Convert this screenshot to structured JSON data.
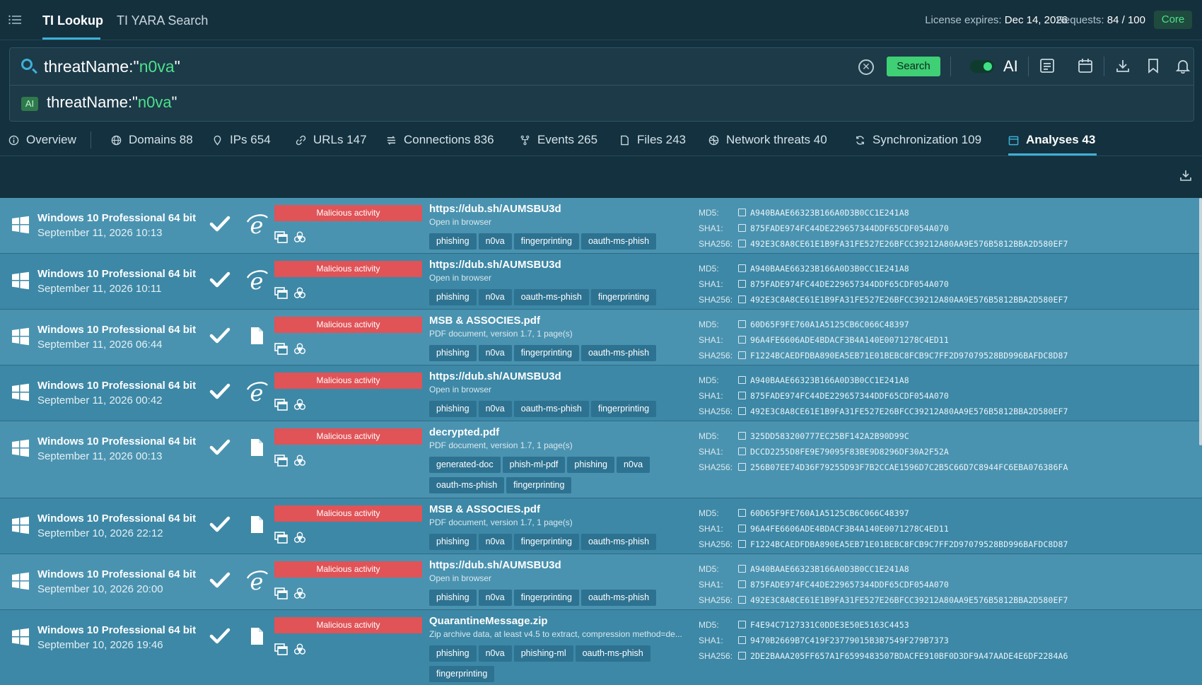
{
  "nav": {
    "tabs": [
      {
        "label": "TI Lookup"
      },
      {
        "label": "TI YARA Search"
      }
    ],
    "license_label": "License expires:",
    "license_value": "Dec 14, 2026",
    "requests_label": "Requests:",
    "requests_value": "84 / 100",
    "plan_badge": "Core"
  },
  "search": {
    "query_prefix": "threatName:\"",
    "query_value": "n0va",
    "query_suffix": "\"",
    "button_label": "Search",
    "ai_toggle": true,
    "ai_label": "AI",
    "ai_badge": "AI",
    "ai_query_prefix": "threatName:\"",
    "ai_query_value": "n0va",
    "ai_query_suffix": "\""
  },
  "tabs": [
    {
      "label": "Overview",
      "icon": "info-icon"
    },
    {
      "label": "Domains 88",
      "icon": "globe-icon"
    },
    {
      "label": "IPs 654",
      "icon": "pin-icon"
    },
    {
      "label": "URLs 147",
      "icon": "link-icon"
    },
    {
      "label": "Connections 836",
      "icon": "connections-icon"
    },
    {
      "label": "Events 265",
      "icon": "events-icon"
    },
    {
      "label": "Files 243",
      "icon": "file-icon"
    },
    {
      "label": "Network threats 40",
      "icon": "network-icon"
    },
    {
      "label": "Synchronization 109",
      "icon": "sync-icon"
    },
    {
      "label": "Analyses 43",
      "icon": "calendar-icon",
      "active": true
    }
  ],
  "hash_labels": {
    "md5": "MD5:",
    "sha1": "SHA1:",
    "sha256": "SHA256:"
  },
  "rows": [
    {
      "os": "Windows 10 Professional 64 bit",
      "date": "September 11, 2026 10:13",
      "app": "ie-icon",
      "verdict": "Malicious activity",
      "title": "https://dub.sh/AUMSBU3d",
      "subtitle": "Open in browser",
      "tags": [
        "phishing",
        "n0va",
        "fingerprinting",
        "oauth-ms-phish"
      ],
      "md5": "A940BAAE66323B166A0D3B0CC1E241A8",
      "sha1": "875FADE974FC44DE229657344DDF65CDF054A070",
      "sha256": "492E3C8A8CE61E1B9FA31FE527E26BFCC39212A80AA9E576B5812BBA2D580EF7"
    },
    {
      "os": "Windows 10 Professional 64 bit",
      "date": "September 11, 2026 10:11",
      "app": "ie-icon",
      "verdict": "Malicious activity",
      "title": "https://dub.sh/AUMSBU3d",
      "subtitle": "Open in browser",
      "tags": [
        "phishing",
        "n0va",
        "oauth-ms-phish",
        "fingerprinting"
      ],
      "md5": "A940BAAE66323B166A0D3B0CC1E241A8",
      "sha1": "875FADE974FC44DE229657344DDF65CDF054A070",
      "sha256": "492E3C8A8CE61E1B9FA31FE527E26BFCC39212A80AA9E576B5812BBA2D580EF7"
    },
    {
      "os": "Windows 10 Professional 64 bit",
      "date": "September 11, 2026 06:44",
      "app": "document-icon",
      "verdict": "Malicious activity",
      "title": "MSB & ASSOCIES.pdf",
      "subtitle": "PDF document, version 1.7, 1 page(s)",
      "tags": [
        "phishing",
        "n0va",
        "fingerprinting",
        "oauth-ms-phish"
      ],
      "md5": "60D65F9FE760A1A5125CB6C066C48397",
      "sha1": "96A4FE6606ADE4BDACF3B4A140E0071278C4ED11",
      "sha256": "F1224BCAEDFDBA890EA5EB71E01BEBC8FCB9C7FF2D97079528BD996BAFDC8D87"
    },
    {
      "os": "Windows 10 Professional 64 bit",
      "date": "September 11, 2026 00:42",
      "app": "ie-icon",
      "verdict": "Malicious activity",
      "title": "https://dub.sh/AUMSBU3d",
      "subtitle": "Open in browser",
      "tags": [
        "phishing",
        "n0va",
        "oauth-ms-phish",
        "fingerprinting"
      ],
      "md5": "A940BAAE66323B166A0D3B0CC1E241A8",
      "sha1": "875FADE974FC44DE229657344DDF65CDF054A070",
      "sha256": "492E3C8A8CE61E1B9FA31FE527E26BFCC39212A80AA9E576B5812BBA2D580EF7"
    },
    {
      "os": "Windows 10 Professional 64 bit",
      "date": "September 11, 2026 00:13",
      "app": "document-icon",
      "verdict": "Malicious activity",
      "title": "decrypted.pdf",
      "subtitle": "PDF document, version 1.7, 1 page(s)",
      "tags": [
        "generated-doc",
        "phish-ml-pdf",
        "phishing",
        "n0va",
        "oauth-ms-phish",
        "fingerprinting"
      ],
      "md5": "325DD583200777EC25BF142A2B90D99C",
      "sha1": "DCCD2255D8FE9E79095F83BE9D8296DF30A2F52A",
      "sha256": "256B07EE74D36F79255D93F7B2CCAE1596D7C2B5C66D7C8944FC6EBA076386FA"
    },
    {
      "os": "Windows 10 Professional 64 bit",
      "date": "September 10, 2026 22:12",
      "app": "document-icon",
      "verdict": "Malicious activity",
      "title": "MSB & ASSOCIES.pdf",
      "subtitle": "PDF document, version 1.7, 1 page(s)",
      "tags": [
        "phishing",
        "n0va",
        "fingerprinting",
        "oauth-ms-phish"
      ],
      "md5": "60D65F9FE760A1A5125CB6C066C48397",
      "sha1": "96A4FE6606ADE4BDACF3B4A140E0071278C4ED11",
      "sha256": "F1224BCAEDFDBA890EA5EB71E01BEBC8FCB9C7FF2D97079528BD996BAFDC8D87"
    },
    {
      "os": "Windows 10 Professional 64 bit",
      "date": "September 10, 2026 20:00",
      "app": "ie-icon",
      "verdict": "Malicious activity",
      "title": "https://dub.sh/AUMSBU3d",
      "subtitle": "Open in browser",
      "tags": [
        "phishing",
        "n0va",
        "fingerprinting",
        "oauth-ms-phish"
      ],
      "md5": "A940BAAE66323B166A0D3B0CC1E241A8",
      "sha1": "875FADE974FC44DE229657344DDF65CDF054A070",
      "sha256": "492E3C8A8CE61E1B9FA31FE527E26BFCC39212A80AA9E576B5812BBA2D580EF7"
    },
    {
      "os": "Windows 10 Professional 64 bit",
      "date": "September 10, 2026 19:46",
      "app": "document-icon",
      "verdict": "Malicious activity",
      "title": "QuarantineMessage.zip",
      "subtitle": "Zip archive data, at least v4.5 to extract, compression method=de...",
      "tags": [
        "phishing",
        "n0va",
        "phishing-ml",
        "oauth-ms-phish",
        "fingerprinting"
      ],
      "md5": "F4E94C7127331C0DDE3E50E5163C4453",
      "sha1": "9470B2669B7C419F23779015B3B7549F279B7373",
      "sha256": "2DE2BAAA205FF657A1F6599483507BDACFE910BF0D3DF9A47AADE4E6DF2284A6"
    }
  ],
  "colors": {
    "accent": "#3fb0d8",
    "success": "#3fcf74",
    "danger": "#e05357"
  }
}
